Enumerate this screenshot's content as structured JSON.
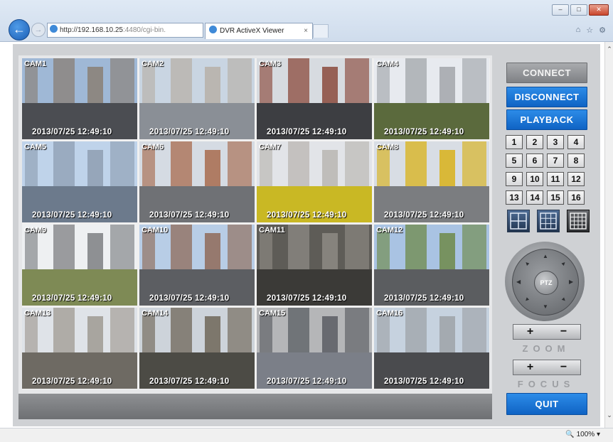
{
  "browser": {
    "address": "http://192.168.10.25:4480/cgi-bin...",
    "address_host": "http://192.168.10.25",
    "address_rest": ":4480/cgi-bin.",
    "tab_title": "DVR ActiveX Viewer",
    "tab_close": "×",
    "zoom_level": "100%"
  },
  "cameras": [
    {
      "label": "CAM1",
      "timestamp": "2013/07/25 12:49:10",
      "sky": "#9fb8d6",
      "ground": "#4b4d52",
      "bldg": "#8a7f74"
    },
    {
      "label": "CAM2",
      "timestamp": "2013/07/25 12:49:10",
      "sky": "#c9d5e2",
      "ground": "#8a8f96",
      "bldg": "#b7b0a8"
    },
    {
      "label": "CAM3",
      "timestamp": "2013/07/25 12:49:10",
      "sky": "#d7dbe0",
      "ground": "#3d3e42",
      "bldg": "#8b4a3c"
    },
    {
      "label": "CAM4",
      "timestamp": "2013/07/25 12:49:10",
      "sky": "#e7eaef",
      "ground": "#5b6a3d",
      "bldg": "#a2a6aa"
    },
    {
      "label": "CAM5",
      "timestamp": "2013/07/25 12:49:10",
      "sky": "#bfd3ea",
      "ground": "#6c7a8c",
      "bldg": "#8e9eb2"
    },
    {
      "label": "CAM6",
      "timestamp": "2013/07/25 12:49:10",
      "sky": "#d5dbe3",
      "ground": "#6f7175",
      "bldg": "#a86b4e"
    },
    {
      "label": "CAM7",
      "timestamp": "2013/07/25 12:49:10",
      "sky": "#e2e4e8",
      "ground": "#c9b824",
      "bldg": "#b9b6b1"
    },
    {
      "label": "CAM8",
      "timestamp": "2013/07/25 12:49:10",
      "sky": "#d8dde4",
      "ground": "#7b7d80",
      "bldg": "#d9b21a"
    },
    {
      "label": "CAM9",
      "timestamp": "2013/07/25 12:49:10",
      "sky": "#eef0f2",
      "ground": "#7e8a55",
      "bldg": "#7d7f82"
    },
    {
      "label": "CAM10",
      "timestamp": "2013/07/25 12:49:10",
      "sky": "#b8cde6",
      "ground": "#5c5e62",
      "bldg": "#8f6a58"
    },
    {
      "label": "CAM11",
      "timestamp": "2013/07/25 12:49:10",
      "sky": "#5e5c57",
      "ground": "#3b3a37",
      "bldg": "#8d8a84"
    },
    {
      "label": "CAM12",
      "timestamp": "2013/07/25 12:49:10",
      "sky": "#a9c3e3",
      "ground": "#5b5d60",
      "bldg": "#6f8a49"
    },
    {
      "label": "CAM13",
      "timestamp": "2013/07/25 12:49:10",
      "sky": "#dfe3e8",
      "ground": "#6e6a63",
      "bldg": "#9f9a92"
    },
    {
      "label": "CAM14",
      "timestamp": "2013/07/25 12:49:10",
      "sky": "#cdd3da",
      "ground": "#4c4b45",
      "bldg": "#6e6658"
    },
    {
      "label": "CAM15",
      "timestamp": "2013/07/25 12:49:10",
      "sky": "#b5b6b8",
      "ground": "#7b7f88",
      "bldg": "#5a5d63"
    },
    {
      "label": "CAM16",
      "timestamp": "2013/07/25 12:49:10",
      "sky": "#c6d2df",
      "ground": "#4a4b4e",
      "bldg": "#9ea3a8"
    }
  ],
  "controls": {
    "connect_label": "CONNECT",
    "disconnect_label": "DISCONNECT",
    "playback_label": "PLAYBACK",
    "channels": [
      "1",
      "2",
      "3",
      "4",
      "5",
      "6",
      "7",
      "8",
      "9",
      "10",
      "11",
      "12",
      "13",
      "14",
      "15",
      "16"
    ],
    "ptz_label": "PTZ",
    "zoom_caption": "ZOOM",
    "focus_caption": "FOCUS",
    "plus": "+",
    "minus": "−",
    "quit_label": "QUIT"
  },
  "colors": {
    "accent_blue": "#1473d6",
    "button_grey": "#8e9094",
    "panel_bg": "#cfd1d4"
  },
  "icons": {
    "back": "back-arrow-icon",
    "forward": "forward-arrow-icon",
    "home": "home-icon",
    "favorites": "star-icon",
    "settings": "gear-icon"
  }
}
